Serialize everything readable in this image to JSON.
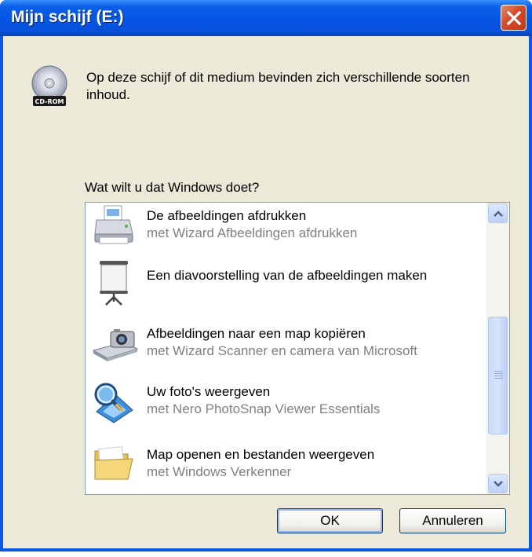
{
  "window": {
    "title": "Mijn schijf (E:)"
  },
  "header": {
    "drive_icon": "cd-rom-icon",
    "drive_label": "CD-ROM",
    "intro_text": "Op deze schijf of dit medium bevinden zich verschillende soorten inhoud."
  },
  "prompt": {
    "question": "Wat wilt u dat Windows doet?"
  },
  "actions": [
    {
      "icon": "printer-icon",
      "label": "De afbeeldingen afdrukken",
      "sub": "met Wizard Afbeeldingen afdrukken"
    },
    {
      "icon": "projector-screen-icon",
      "label": "Een diavoorstelling van de afbeeldingen maken",
      "sub": ""
    },
    {
      "icon": "camera-scanner-icon",
      "label": "Afbeeldingen naar een map kopiëren",
      "sub": "met Wizard Scanner en camera van Microsoft"
    },
    {
      "icon": "photo-viewer-icon",
      "label": "Uw foto's weergeven",
      "sub": "met Nero PhotoSnap Viewer Essentials"
    },
    {
      "icon": "folder-icon",
      "label": "Map openen en bestanden weergeven",
      "sub": "met Windows Verkenner"
    }
  ],
  "buttons": {
    "ok": "OK",
    "cancel": "Annuleren"
  }
}
